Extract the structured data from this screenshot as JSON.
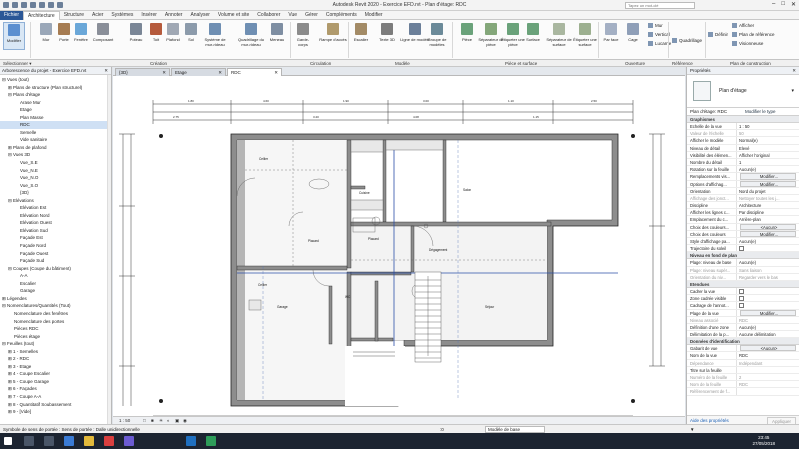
{
  "window": {
    "title": "Autodesk Revit 2020 - Exercice EFD.rvt - Plan d'étage: RDC",
    "search_placeholder": "Tapez un mot-clé"
  },
  "ribbon_tabs": [
    "Fichier",
    "Architecture",
    "Structure",
    "Acier",
    "Systèmes",
    "Insérer",
    "Annoter",
    "Analyser",
    "Volume et site",
    "Collaborer",
    "Vue",
    "Gérer",
    "Compléments",
    "Modifier"
  ],
  "ribbon_active_tab": "Architecture",
  "ribbon": {
    "buttons": [
      {
        "label": "Modifier",
        "icon": "cursor-icon"
      },
      {
        "label": "Mur",
        "icon": "wall-icon"
      },
      {
        "label": "Porte",
        "icon": "door-icon"
      },
      {
        "label": "Fenêtre",
        "icon": "window-icon"
      },
      {
        "label": "Composant",
        "icon": "component-icon"
      },
      {
        "label": "Poteau",
        "icon": "column-icon"
      },
      {
        "label": "Toit",
        "icon": "roof-icon"
      },
      {
        "label": "Plafond",
        "icon": "ceiling-icon"
      },
      {
        "label": "Sol",
        "icon": "floor-icon"
      },
      {
        "label": "Système de mur-rideau",
        "icon": "curtain-system-icon"
      },
      {
        "label": "Quadrillage du mur-rideau",
        "icon": "curtain-grid-icon"
      },
      {
        "label": "Meneau",
        "icon": "mullion-icon"
      },
      {
        "label": "Garde-corps",
        "icon": "railing-icon"
      },
      {
        "label": "Rampe d'accès",
        "icon": "ramp-icon"
      },
      {
        "label": "Escalier",
        "icon": "stair-icon"
      },
      {
        "label": "Texte 3D",
        "icon": "model-text-icon"
      },
      {
        "label": "Ligne de modèle",
        "icon": "model-line-icon"
      },
      {
        "label": "Groupe de modèles",
        "icon": "model-group-icon"
      },
      {
        "label": "Pièce",
        "icon": "room-icon"
      },
      {
        "label": "Séparateur de pièce",
        "icon": "room-separator-icon"
      },
      {
        "label": "Étiqueter une pièce",
        "icon": "tag-room-icon"
      },
      {
        "label": "Surface",
        "icon": "area-icon"
      },
      {
        "label": "Séparateur de surface",
        "icon": "area-boundary-icon"
      },
      {
        "label": "Étiqueter une surface",
        "icon": "tag-area-icon"
      },
      {
        "label": "Par face",
        "icon": "by-face-icon"
      },
      {
        "label": "Cage",
        "icon": "shaft-icon"
      }
    ],
    "small_items": [
      "Mur",
      "Vertical",
      "Lucarne",
      "Quadrillage",
      "Définir",
      "Afficher",
      "Plan de référence",
      "Visionneuse"
    ],
    "panel_labels": [
      "Sélectionner",
      "Création",
      "Circulation",
      "Modèle",
      "Pièce et surface",
      "Ouverture",
      "Référence",
      "Plan de construction"
    ]
  },
  "select_bar": {
    "label": "Sélectionner ▾"
  },
  "browser": {
    "title": "Arborescence du projet - Exercice EFD.rvt",
    "tree": [
      {
        "label": "Vues (tout)",
        "depth": 0,
        "toggle": "⊟"
      },
      {
        "label": "Plans de structure (Plan structurel)",
        "depth": 1,
        "toggle": "⊞"
      },
      {
        "label": "Plans d'étage",
        "depth": 1,
        "toggle": "⊟"
      },
      {
        "label": "Arase Mur",
        "depth": 3,
        "toggle": ""
      },
      {
        "label": "Etage",
        "depth": 3,
        "toggle": ""
      },
      {
        "label": "Plan Masse",
        "depth": 3,
        "toggle": ""
      },
      {
        "label": "RDC",
        "depth": 3,
        "toggle": "",
        "selected": true
      },
      {
        "label": "Semelle",
        "depth": 3,
        "toggle": ""
      },
      {
        "label": "Vide sanitaire",
        "depth": 3,
        "toggle": ""
      },
      {
        "label": "Plans de plafond",
        "depth": 1,
        "toggle": "⊞"
      },
      {
        "label": "Vues 3D",
        "depth": 1,
        "toggle": "⊟"
      },
      {
        "label": "Vue_S.E",
        "depth": 3,
        "toggle": ""
      },
      {
        "label": "Vue_N.E",
        "depth": 3,
        "toggle": ""
      },
      {
        "label": "Vue_N.O",
        "depth": 3,
        "toggle": ""
      },
      {
        "label": "Vue_S.O",
        "depth": 3,
        "toggle": ""
      },
      {
        "label": "{3D}",
        "depth": 3,
        "toggle": ""
      },
      {
        "label": "Elévations",
        "depth": 1,
        "toggle": "⊟"
      },
      {
        "label": "Elévation Est",
        "depth": 3,
        "toggle": ""
      },
      {
        "label": "Elévation Nord",
        "depth": 3,
        "toggle": ""
      },
      {
        "label": "Elévation Ouest",
        "depth": 3,
        "toggle": ""
      },
      {
        "label": "Elévation Sud",
        "depth": 3,
        "toggle": ""
      },
      {
        "label": "Façade Est",
        "depth": 3,
        "toggle": ""
      },
      {
        "label": "Façade Nord",
        "depth": 3,
        "toggle": ""
      },
      {
        "label": "Façade Ouest",
        "depth": 3,
        "toggle": ""
      },
      {
        "label": "Façade Sud",
        "depth": 3,
        "toggle": ""
      },
      {
        "label": "Coupes (Coupe du bâtiment)",
        "depth": 1,
        "toggle": "⊟"
      },
      {
        "label": "A-A",
        "depth": 3,
        "toggle": ""
      },
      {
        "label": "Escalier",
        "depth": 3,
        "toggle": ""
      },
      {
        "label": "Garage",
        "depth": 3,
        "toggle": ""
      },
      {
        "label": "Légendes",
        "depth": 0,
        "toggle": "⊞"
      },
      {
        "label": "Nomenclatures/Quantités (Tout)",
        "depth": 0,
        "toggle": "⊟"
      },
      {
        "label": "Nomenclature des fenêtres",
        "depth": 2,
        "toggle": ""
      },
      {
        "label": "Nomenclature des portes",
        "depth": 2,
        "toggle": ""
      },
      {
        "label": "Pièces RDC",
        "depth": 2,
        "toggle": ""
      },
      {
        "label": "Pièces étage",
        "depth": 2,
        "toggle": ""
      },
      {
        "label": "Feuilles (tout)",
        "depth": 0,
        "toggle": "⊟"
      },
      {
        "label": "1 - Semelles",
        "depth": 1,
        "toggle": "⊞"
      },
      {
        "label": "2 - RDC",
        "depth": 1,
        "toggle": "⊞"
      },
      {
        "label": "3 - Etage",
        "depth": 1,
        "toggle": "⊞"
      },
      {
        "label": "4 - Coupe Escalier",
        "depth": 1,
        "toggle": "⊞"
      },
      {
        "label": "5 - Coupe Garage",
        "depth": 1,
        "toggle": "⊞"
      },
      {
        "label": "6 - Façades",
        "depth": 1,
        "toggle": "⊞"
      },
      {
        "label": "7 - Coupe A-A",
        "depth": 1,
        "toggle": "⊞"
      },
      {
        "label": "8 - Quantitatif Soubassement",
        "depth": 1,
        "toggle": "⊞"
      },
      {
        "label": "9 - [Vide]",
        "depth": 1,
        "toggle": "⊞"
      }
    ]
  },
  "view_tabs": [
    {
      "label": "{3D}",
      "active": false
    },
    {
      "label": "Etage",
      "active": false
    },
    {
      "label": "RDC",
      "active": true
    }
  ],
  "plan": {
    "room_labels": [
      "Cellier",
      "Cuisine",
      "Salon",
      "Placard",
      "Placard",
      "Dégagement",
      "WC",
      "Séjour",
      "Garage",
      "Cellier"
    ],
    "dimension_texts": [
      "1.80",
      "4.60",
      "1.90",
      "3.00",
      "1.10",
      "2.50",
      "4.08",
      "3.20",
      "2.75",
      "1.15"
    ]
  },
  "view_bar": {
    "scale": "1 : 50"
  },
  "properties": {
    "title": "Propriétés",
    "type_name": "Plan d'étage",
    "instance": "Plan d'étage: RDC",
    "edit_type": "Modifier le type",
    "groups": [
      {
        "name": "Graphismes",
        "rows": [
          {
            "k": "Echelle de la vue",
            "v": "1 : 50"
          },
          {
            "k": "Valeur de l'échelle",
            "v": "50",
            "grey": true
          },
          {
            "k": "Afficher le modèle",
            "v": "Normal(e)"
          },
          {
            "k": "Niveau de détail",
            "v": "Elevé"
          },
          {
            "k": "Visibilité des élémen...",
            "v": "Afficher l'original"
          },
          {
            "k": "Nombre du détail",
            "v": "1"
          },
          {
            "k": "Rotation sur la feuille",
            "v": "Aucun(e)"
          },
          {
            "k": "Remplacements vis...",
            "v": "Modifier...",
            "btn": true
          },
          {
            "k": "Options d'affichag...",
            "v": "Modifier...",
            "btn": true
          },
          {
            "k": "Orientation",
            "v": "Nord du projet"
          },
          {
            "k": "Affichage des jonct...",
            "v": "Nettoyer toutes les j...",
            "grey": true
          },
          {
            "k": "Discipline",
            "v": "Architecture"
          },
          {
            "k": "Afficher les lignes c...",
            "v": "Par discipline"
          },
          {
            "k": "Emplacement du c...",
            "v": "Arrière-plan"
          },
          {
            "k": "Choix des couleurs...",
            "v": "<Aucun>",
            "btn": true
          },
          {
            "k": "Choix des couleurs",
            "v": "Modifier...",
            "btn": true
          },
          {
            "k": "Style d'affichage pa...",
            "v": "Aucun(e)"
          },
          {
            "k": "Trajectoire du soleil",
            "v": "",
            "check": true
          }
        ]
      },
      {
        "name": "Niveau en fond de plan",
        "rows": [
          {
            "k": "Plage: niveau de base",
            "v": "Aucun(e)"
          },
          {
            "k": "Plage: niveau supér...",
            "v": "Sans liaison",
            "grey": true
          },
          {
            "k": "Orientation du niv...",
            "v": "Regarder vers le bas",
            "grey": true
          }
        ]
      },
      {
        "name": "Etendues",
        "rows": [
          {
            "k": "Cadrer la vue",
            "v": "",
            "check": true
          },
          {
            "k": "Zone cadrée visible",
            "v": "",
            "check": true
          },
          {
            "k": "Cadrage de l'annot...",
            "v": "",
            "check": true
          },
          {
            "k": "Plage de la vue",
            "v": "Modifier...",
            "btn": true
          },
          {
            "k": "Niveau associé",
            "v": "RDC",
            "grey": true
          },
          {
            "k": "Définition d'une zone",
            "v": "Aucun(e)"
          },
          {
            "k": "Délimitation de la p...",
            "v": "Aucune délimitation"
          }
        ]
      },
      {
        "name": "Données d'identification",
        "rows": [
          {
            "k": "Gabarit de vue",
            "v": "<Aucun>",
            "btn": true
          },
          {
            "k": "Nom de la vue",
            "v": "RDC"
          },
          {
            "k": "Dépendance",
            "v": "Indépendant",
            "grey": true
          },
          {
            "k": "Titre sur la feuille",
            "v": ""
          },
          {
            "k": "Numéro de la feuille",
            "v": "2",
            "grey": true
          },
          {
            "k": "Nom de la feuille",
            "v": "RDC",
            "grey": true
          },
          {
            "k": "Référencement de f...",
            "v": "",
            "grey": true
          }
        ]
      }
    ],
    "help_link": "Aide des propriétés",
    "apply": "Appliquer"
  },
  "status_bar": {
    "text": "Symbole de sens de portée : Sens de portée : Dalle unidirectionnelle",
    "model": "Modèle de base",
    "counter": ":0"
  },
  "taskbar": {
    "time": "23:45",
    "date": "27/05/2018"
  }
}
